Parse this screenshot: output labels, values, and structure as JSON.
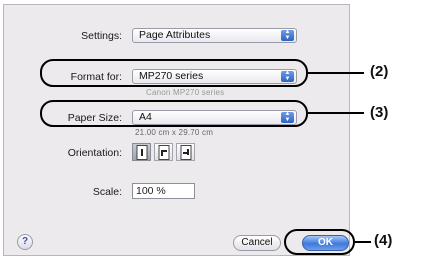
{
  "settings": {
    "label": "Settings:",
    "value": "Page Attributes"
  },
  "format_for": {
    "label": "Format for:",
    "value": "MP270 series",
    "sub": "Canon MP270 series"
  },
  "paper_size": {
    "label": "Paper Size:",
    "value": "A4",
    "sub": "21.00 cm x 29.70 cm"
  },
  "orientation": {
    "label": "Orientation:",
    "options": [
      "portrait",
      "landscape-left",
      "landscape-right"
    ],
    "selected": "portrait"
  },
  "scale": {
    "label": "Scale:",
    "value": "100 %"
  },
  "help": {
    "label": "?"
  },
  "buttons": {
    "cancel": "Cancel",
    "ok": "OK"
  },
  "markers": {
    "format_for": "(2)",
    "paper_size": "(3)",
    "ok": "(4)"
  }
}
